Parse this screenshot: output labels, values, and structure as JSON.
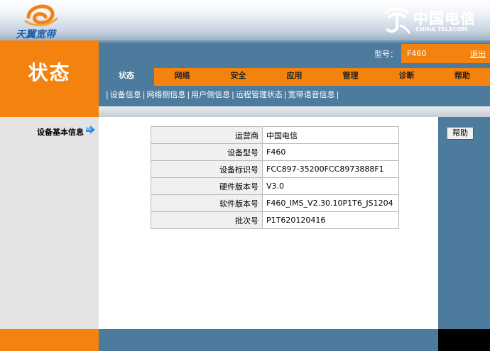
{
  "header": {
    "brand_left": "天翼宽带",
    "brand_right_cn": "中国电信",
    "brand_right_en": "CHINA TELECOM"
  },
  "section_title": "状态",
  "model": {
    "label": "型号：",
    "value": "F460",
    "logout": "退出"
  },
  "tabs": [
    {
      "label": "状态"
    },
    {
      "label": "网络"
    },
    {
      "label": "安全"
    },
    {
      "label": "应用"
    },
    {
      "label": "管理"
    },
    {
      "label": "诊断"
    },
    {
      "label": "帮助"
    }
  ],
  "subnav": [
    {
      "label": "设备信息"
    },
    {
      "label": "网络侧信息"
    },
    {
      "label": "用户侧信息"
    },
    {
      "label": "远程管理状态"
    },
    {
      "label": "宽带语音信息"
    }
  ],
  "sidebar": {
    "item": "设备基本信息"
  },
  "help_button": "帮助",
  "info_table": [
    {
      "label": "运营商",
      "value": "中国电信"
    },
    {
      "label": "设备型号",
      "value": "F460"
    },
    {
      "label": "设备标识号",
      "value": "FCC897-35200FCC8973888F1"
    },
    {
      "label": "硬件版本号",
      "value": "V3.0"
    },
    {
      "label": "软件版本号",
      "value": "F460_IMS_V2.30.10P1T6_JS1204"
    },
    {
      "label": "批次号",
      "value": "P1T620120416"
    }
  ],
  "colors": {
    "orange": "#f4820f",
    "blue": "#4d7b9d"
  }
}
